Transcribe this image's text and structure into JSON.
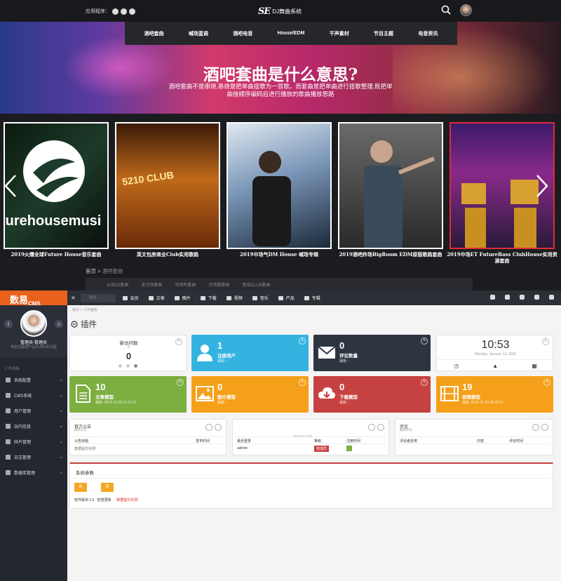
{
  "site": {
    "apps_label": "应用程序：",
    "brand_mark": "SE",
    "brand_name": "DJ舞曲系统",
    "nav": [
      "酒吧套曲",
      "喊场蓝调",
      "酒吧电音",
      "House/EDM",
      "干声素材",
      "节目主题",
      "电音资讯"
    ],
    "banner_title": "酒吧套曲是什么意思?",
    "banner_sub": "酒吧套曲不是串烧,串烧是把单曲接歌为一首歌。而套曲是把单曲进行接歌整理,既把单曲按顺序编码后进行播放的歌曲播放思路",
    "cards": [
      {
        "caption": "2019火爆全球Future House音乐套曲",
        "art_text": "turehousemusi"
      },
      {
        "caption": "英文包房商业Club实用歌路",
        "art_text": "5210 CLUB"
      },
      {
        "caption": "2019中场气DM House 喊场专辑",
        "art_text": ""
      },
      {
        "caption": "2019酒吧炸场BigRoom EDM原版歌路套曲",
        "art_text": ""
      },
      {
        "caption": "2019中场ET FutureBass ClubHouse实用资源套曲",
        "art_text": ""
      }
    ],
    "breadcrumb_home": "首页 >",
    "breadcrumb_current": "酒吧套曲",
    "sub_tabs": [
      "元旦DJ套曲",
      "无冷场套曲",
      "中场所套曲",
      "开场慢套曲",
      "串烧CLUB套曲"
    ]
  },
  "admin": {
    "brand": "数易",
    "brand_suffix": "CMS",
    "search_placeholder": "搜索...",
    "topnav": [
      "会员",
      "文章",
      "图片",
      "下载",
      "视频",
      "音乐",
      "产品",
      "专辑"
    ],
    "user_name": "管理员-管理员",
    "user_group": "枫泉互联网产品从0到1的过程",
    "work_label": "工作面板",
    "menu": [
      "系统配置",
      "CMS系统",
      "用户管理",
      "站内信息",
      "碎片管理",
      "日志管理",
      "数据库管理"
    ],
    "crumb": "首页 > 工作面板",
    "page_title": "插件",
    "visits": {
      "title": "新访问数",
      "sub": "0",
      "value": "0"
    },
    "stats": [
      {
        "value": "1",
        "label": "注册用户",
        "meta": "最新: -",
        "color": "#35b3e0"
      },
      {
        "value": "0",
        "label": "评论数量",
        "meta": "最新: -",
        "color": "#2d3540"
      },
      {
        "value": "10",
        "label": "文章模型",
        "meta": "最新: 2018-12-29 11:12:11",
        "color": "#7cae40"
      },
      {
        "value": "0",
        "label": "图片模型",
        "meta": "最新: -",
        "color": "#f5a01a"
      },
      {
        "value": "0",
        "label": "下载模型",
        "meta": "最新: -",
        "color": "#c64240"
      },
      {
        "value": "19",
        "label": "视频模型",
        "meta": "最新: 2018-11-30 08:22:57",
        "color": "#f5a01a"
      }
    ],
    "clock": {
      "time": "10:53",
      "date": "Monday, January 13, 2020"
    },
    "notice": {
      "title": "官方公告",
      "sub": "最新公告",
      "col1": "公告标题",
      "col2": "发布时间",
      "empty": "数据提交失败!"
    },
    "login": {
      "col1": "最近登录",
      "col2": "等级",
      "col3": "注册时间",
      "user": "admin",
      "level": "管理员",
      "watermark": "leqmoo.com"
    },
    "comment": {
      "title": "评论",
      "sub": "最新评论",
      "col1": "评论者名称",
      "col2": "内容",
      "col3": "评论时间"
    },
    "sysparams": {
      "title": "系统参数",
      "btn1": "系统已启",
      "btn2": "清理已启",
      "version": "软件版本:1.0",
      "check": "检查更新",
      "fail": "数据提交失败!"
    }
  }
}
